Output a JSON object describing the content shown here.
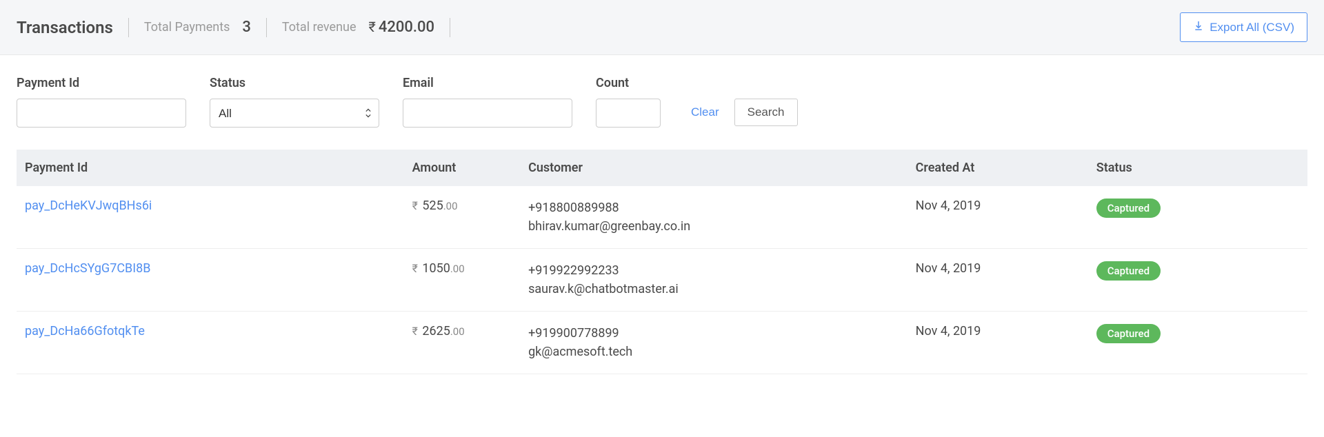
{
  "header": {
    "title": "Transactions",
    "total_payments_label": "Total Payments",
    "total_payments_value": "3",
    "total_revenue_label": "Total revenue",
    "currency_symbol": "₹",
    "total_revenue_int": "4200",
    "total_revenue_dec": ".00",
    "export_label": "Export All (CSV)"
  },
  "filters": {
    "payment_id": {
      "label": "Payment Id",
      "value": ""
    },
    "status": {
      "label": "Status",
      "selected": "All"
    },
    "email": {
      "label": "Email",
      "value": ""
    },
    "count": {
      "label": "Count",
      "value": ""
    },
    "clear": "Clear",
    "search": "Search"
  },
  "columns": {
    "payment_id": "Payment Id",
    "amount": "Amount",
    "customer": "Customer",
    "created_at": "Created At",
    "status": "Status"
  },
  "rows": [
    {
      "id": "pay_DcHeKVJwqBHs6i",
      "amount_int": "525",
      "amount_dec": ".00",
      "phone": "+918800889988",
      "email": "bhirav.kumar@greenbay.co.in",
      "created_at": "Nov 4, 2019",
      "status": "Captured"
    },
    {
      "id": "pay_DcHcSYgG7CBI8B",
      "amount_int": "1050",
      "amount_dec": ".00",
      "phone": "+919922992233",
      "email": "saurav.k@chatbotmaster.ai",
      "created_at": "Nov 4, 2019",
      "status": "Captured"
    },
    {
      "id": "pay_DcHa66GfotqkTe",
      "amount_int": "2625",
      "amount_dec": ".00",
      "phone": "+919900778899",
      "email": "gk@acmesoft.tech",
      "created_at": "Nov 4, 2019",
      "status": "Captured"
    }
  ],
  "currency_symbol": "₹"
}
